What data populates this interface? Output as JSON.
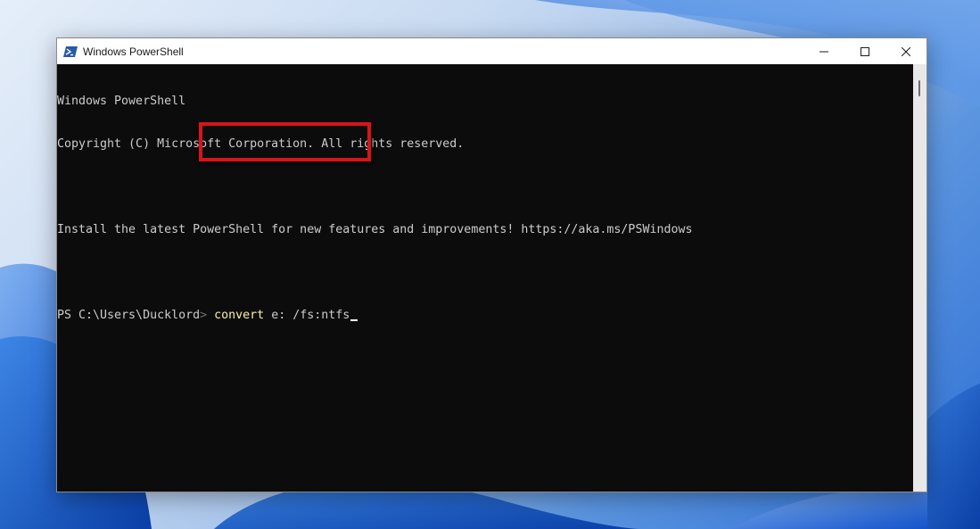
{
  "window": {
    "title": "Windows PowerShell",
    "icon": "powershell-icon"
  },
  "controls": {
    "minimize_icon": "minimize-icon",
    "maximize_icon": "maximize-icon",
    "close_icon": "close-icon"
  },
  "terminal": {
    "lines": [
      "Windows PowerShell",
      "Copyright (C) Microsoft Corporation. All rights reserved.",
      "",
      "Install the latest PowerShell for new features and improvements! https://aka.ms/PSWindows",
      ""
    ],
    "prompt": {
      "path": "PS C:\\Users\\Ducklord",
      "separator": ">",
      "command_verb": "convert",
      "command_args": " e: /fs:ntfs"
    }
  },
  "colors": {
    "terminal_bg": "#0c0c0c",
    "terminal_text": "#cccccc",
    "command_verb": "#f9f1a5",
    "highlight": "#d8141b"
  }
}
